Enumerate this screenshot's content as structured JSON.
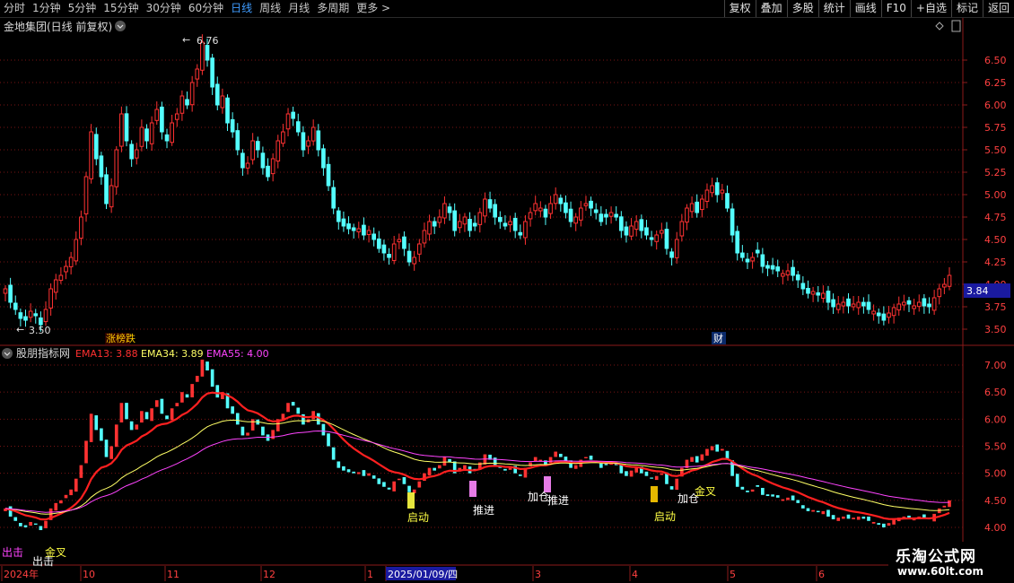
{
  "toolbar": {
    "periods": [
      "分时",
      "1分钟",
      "5分钟",
      "15分钟",
      "30分钟",
      "60分钟",
      "日线",
      "周线",
      "月线",
      "多周期",
      "更多 >"
    ],
    "active_index": 6,
    "actions": [
      "复权",
      "叠加",
      "多股",
      "统计",
      "画线",
      "F10",
      "+自选",
      "标记",
      "返回"
    ]
  },
  "main_chart": {
    "title": "金地集团(日线 前复权)",
    "high_marker": "6.76",
    "low_marker": "3.50",
    "price_ticks": [
      "6.50",
      "6.25",
      "6.00",
      "5.75",
      "5.50",
      "5.25",
      "5.00",
      "4.75",
      "4.50",
      "4.25",
      "4.00",
      "3.75",
      "3.50"
    ],
    "current_price": "3.84",
    "event_tag": "涨榜跌",
    "finance_tag": "财"
  },
  "indicator": {
    "name": "股朋指标网",
    "ema13_label": "EMA13: 3.88",
    "ema34_label": "EMA34: 3.89",
    "ema55_label": "EMA55: 4.00",
    "ticks": [
      "7.00",
      "6.50",
      "6.00",
      "5.50",
      "5.00",
      "4.50",
      "4.00"
    ],
    "signals": [
      "启动",
      "推进",
      "加仓",
      "推进",
      "启动",
      "加仓",
      "金叉",
      "金叉",
      "出击",
      "出击"
    ]
  },
  "x_axis": {
    "labels": [
      "2024年",
      "10",
      "11",
      "12",
      "1",
      "2025/01/09/四",
      "3",
      "4",
      "5",
      "6"
    ]
  },
  "watermark": {
    "line1": "乐淘公式网",
    "line2": "www.60lt.com"
  },
  "colors": {
    "up": "#ff3232",
    "down": "#54ffff",
    "ema13": "#ff2020",
    "ema34": "#ffff66",
    "ema55": "#ff44ff",
    "active_period": "#3f9cff"
  },
  "chart_data": {
    "type": "candlestick",
    "ylim": [
      3.4,
      6.85
    ],
    "ylim_indicator": [
      3.75,
      7.25
    ],
    "close": [
      3.95,
      3.8,
      3.72,
      3.62,
      3.6,
      3.7,
      3.65,
      3.55,
      3.72,
      3.95,
      4.05,
      4.1,
      4.2,
      4.3,
      4.5,
      4.75,
      5.2,
      5.7,
      5.4,
      5.2,
      4.9,
      5.1,
      5.5,
      5.9,
      5.6,
      5.4,
      5.5,
      5.75,
      5.6,
      5.8,
      5.95,
      5.7,
      5.6,
      5.8,
      5.9,
      6.1,
      6.0,
      6.25,
      6.4,
      6.7,
      6.5,
      6.2,
      6.0,
      6.1,
      5.8,
      5.7,
      5.5,
      5.3,
      5.35,
      5.6,
      5.5,
      5.3,
      5.2,
      5.4,
      5.6,
      5.7,
      5.9,
      5.85,
      5.7,
      5.5,
      5.6,
      5.75,
      5.5,
      5.3,
      5.1,
      4.85,
      4.7,
      4.65,
      4.62,
      4.6,
      4.62,
      4.55,
      4.6,
      4.5,
      4.4,
      4.35,
      4.3,
      4.45,
      4.5,
      4.4,
      4.25,
      4.3,
      4.45,
      4.6,
      4.7,
      4.65,
      4.75,
      4.9,
      4.8,
      4.6,
      4.7,
      4.75,
      4.6,
      4.65,
      4.8,
      4.95,
      4.85,
      4.75,
      4.7,
      4.65,
      4.7,
      4.6,
      4.55,
      4.7,
      4.8,
      4.9,
      4.85,
      4.75,
      4.9,
      5.0,
      4.9,
      4.8,
      4.7,
      4.75,
      4.85,
      4.9,
      4.85,
      4.8,
      4.7,
      4.75,
      4.8,
      4.75,
      4.6,
      4.55,
      4.65,
      4.7,
      4.6,
      4.55,
      4.5,
      4.55,
      4.6,
      4.4,
      4.3,
      4.5,
      4.7,
      4.85,
      4.9,
      4.8,
      4.95,
      5.05,
      5.1,
      5.0,
      5.05,
      4.85,
      4.55,
      4.35,
      4.3,
      4.25,
      4.3,
      4.35,
      4.2,
      4.18,
      4.17,
      4.15,
      4.12,
      4.15,
      4.1,
      4.05,
      3.95,
      3.9,
      3.92,
      3.88,
      3.9,
      3.8,
      3.75,
      3.78,
      3.8,
      3.76,
      3.78,
      3.8,
      3.76,
      3.72,
      3.7,
      3.65,
      3.6,
      3.68,
      3.74,
      3.78,
      3.8,
      3.78,
      3.76,
      3.8,
      3.76,
      3.75,
      3.85,
      3.95,
      4.0,
      4.1
    ]
  }
}
